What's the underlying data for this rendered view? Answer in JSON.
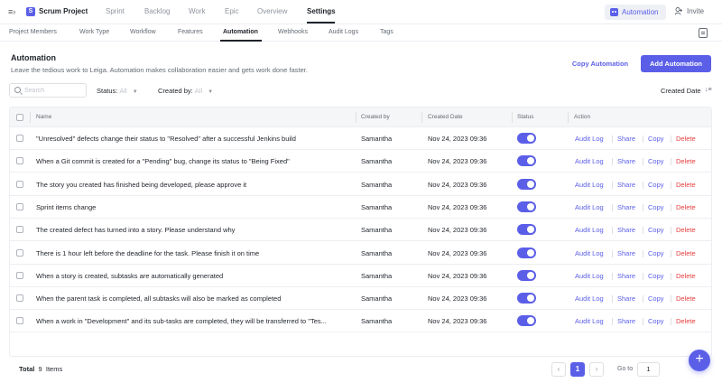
{
  "header": {
    "project_logo": "S",
    "project_name": "Scrum Project",
    "nav": [
      "Sprint",
      "Backlog",
      "Work",
      "Epic",
      "Overview",
      "Settings"
    ],
    "active_nav": "Settings",
    "automation_label": "Automation",
    "invite_label": "Invite"
  },
  "subnav": {
    "tabs": [
      "Project Members",
      "Work Type",
      "Workflow",
      "Features",
      "Automation",
      "Webhooks",
      "Audit Logs",
      "Tags"
    ],
    "active": "Automation"
  },
  "page": {
    "title": "Automation",
    "description": "Leave the tedious work to Leiga. Automation makes collaboration easier and gets work done faster.",
    "copy_button": "Copy Automation",
    "add_button": "Add Automation"
  },
  "filters": {
    "search_placeholder": "Search",
    "status_label": "Status:",
    "status_value": "All",
    "created_by_label": "Created by:",
    "created_by_value": "All",
    "sort_label": "Created Date"
  },
  "table": {
    "columns": [
      "Name",
      "Created by",
      "Created Date",
      "Status",
      "Action"
    ],
    "actions": [
      "Audit Log",
      "Share",
      "Copy",
      "Delete"
    ],
    "rows": [
      {
        "name": "\"Unresolved\" defects change their status to \"Resolved\" after a successful Jenkins build",
        "created_by": "Samantha",
        "created_date": "Nov 24, 2023 09:36",
        "enabled": true
      },
      {
        "name": "When a Git commit is created for a \"Pending\" bug, change its status to \"Being Fixed\"",
        "created_by": "Samantha",
        "created_date": "Nov 24, 2023 09:36",
        "enabled": true
      },
      {
        "name": "The story you created has finished being developed, please approve it",
        "created_by": "Samantha",
        "created_date": "Nov 24, 2023 09:36",
        "enabled": true
      },
      {
        "name": "Sprint items change",
        "created_by": "Samantha",
        "created_date": "Nov 24, 2023 09:36",
        "enabled": true
      },
      {
        "name": "The created defect has turned into a story. Please understand why",
        "created_by": "Samantha",
        "created_date": "Nov 24, 2023 09:36",
        "enabled": true
      },
      {
        "name": "There is 1 hour left before the deadline for the task. Please finish it on time",
        "created_by": "Samantha",
        "created_date": "Nov 24, 2023 09:36",
        "enabled": true
      },
      {
        "name": "When a story is created, subtasks are automatically generated",
        "created_by": "Samantha",
        "created_date": "Nov 24, 2023 09:36",
        "enabled": true
      },
      {
        "name": "When the parent task is completed, all subtasks will also be marked as completed",
        "created_by": "Samantha",
        "created_date": "Nov 24, 2023 09:36",
        "enabled": true
      },
      {
        "name": "When a work in \"Development\" and its sub-tasks are completed, they will be transferred to \"Tes...",
        "created_by": "Samantha",
        "created_date": "Nov 24, 2023 09:36",
        "enabled": true
      }
    ]
  },
  "footer": {
    "total_label": "Total",
    "total_count": "9",
    "items_label": "Items",
    "current_page": "1",
    "goto_label": "Go to",
    "goto_value": "1"
  },
  "colors": {
    "accent": "#5b5fe8",
    "danger": "#e53e3e"
  },
  "icons": {
    "collapse": "sidebar-collapse-icon",
    "automation": "robot-icon",
    "invite": "person-add-icon",
    "clipboard": "clipboard-icon",
    "search": "search-icon",
    "sort": "sort-icon",
    "fab": "plus-icon"
  }
}
